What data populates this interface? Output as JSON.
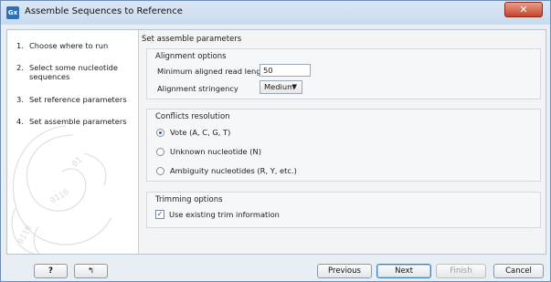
{
  "window": {
    "title": "Assemble Sequences to Reference",
    "app_icon": "Gx",
    "close_symbol": "✕"
  },
  "steps": [
    {
      "num": "1.",
      "label": "Choose where to run"
    },
    {
      "num": "2.",
      "label": "Select some nucleotide sequences"
    },
    {
      "num": "3.",
      "label": "Set reference parameters"
    },
    {
      "num": "4.",
      "label": "Set assemble parameters"
    }
  ],
  "main": {
    "heading": "Set assemble parameters",
    "alignment": {
      "title": "Alignment options",
      "min_length_label": "Minimum aligned read length",
      "min_length_value": "50",
      "stringency_label": "Alignment stringency",
      "stringency_value": "Medium"
    },
    "conflicts": {
      "title": "Conflicts resolution",
      "options": [
        {
          "label": "Vote (A, C, G, T)",
          "selected": true
        },
        {
          "label": "Unknown nucleotide (N)",
          "selected": false
        },
        {
          "label": "Ambiguity nucleotides (R, Y, etc.)",
          "selected": false
        }
      ]
    },
    "trimming": {
      "title": "Trimming options",
      "checkbox_label": "Use existing trim information",
      "checked": true
    }
  },
  "footer": {
    "help_label": "?",
    "reset_icon": "↰",
    "previous": "Previous",
    "next": "Next",
    "finish": "Finish",
    "cancel": "Cancel"
  }
}
